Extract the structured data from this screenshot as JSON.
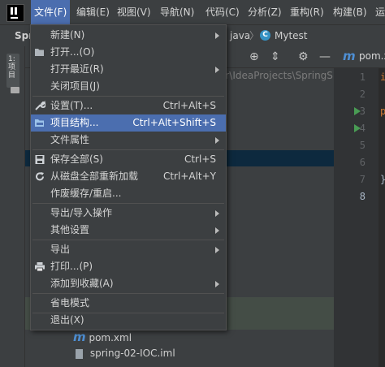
{
  "menubar": {
    "items": [
      {
        "label": "文件(F)"
      },
      {
        "label": "编辑(E)"
      },
      {
        "label": "视图(V)"
      },
      {
        "label": "导航(N)"
      },
      {
        "label": "代码(C)"
      },
      {
        "label": "分析(Z)"
      },
      {
        "label": "重构(R)"
      },
      {
        "label": "构建(B)"
      },
      {
        "label": "运"
      }
    ]
  },
  "navbar": {
    "project_fragment": "Spr",
    "crumb_java": "java",
    "crumb_class": "Mytest",
    "separator": "〉"
  },
  "left_strip": {
    "tab_label": "1: 项目"
  },
  "project_panel": {
    "path_fragment": "or\\IdeaProjects\\SpringS",
    "tree": [
      {
        "name": "pom.xml",
        "icon": "maven-icon"
      },
      {
        "name": "spring-02-IOC.iml",
        "icon": "module-file-icon"
      }
    ]
  },
  "editor": {
    "tab_label": "pom.x",
    "line_numbers": [
      "1",
      "2",
      "3",
      "4",
      "5",
      "6",
      "7",
      "8"
    ]
  },
  "file_menu": {
    "items": [
      {
        "label": "新建(N)",
        "shortcut": "",
        "submenu": true,
        "icon": ""
      },
      {
        "label": "打开...(O)",
        "shortcut": "",
        "submenu": false,
        "icon": "folder-open-icon"
      },
      {
        "label": "打开最近(R)",
        "shortcut": "",
        "submenu": true,
        "icon": ""
      },
      {
        "label": "关闭项目(J)",
        "shortcut": "",
        "submenu": false,
        "icon": ""
      },
      {
        "label": "设置(T)...",
        "shortcut": "Ctrl+Alt+S",
        "submenu": false,
        "icon": "wrench-icon"
      },
      {
        "label": "项目结构...",
        "shortcut": "Ctrl+Alt+Shift+S",
        "submenu": false,
        "icon": "project-structure-icon",
        "selected": true
      },
      {
        "label": "文件属性",
        "shortcut": "",
        "submenu": true,
        "icon": ""
      },
      {
        "label": "保存全部(S)",
        "shortcut": "Ctrl+S",
        "submenu": false,
        "icon": "save-icon"
      },
      {
        "label": "从磁盘全部重新加载",
        "shortcut": "Ctrl+Alt+Y",
        "submenu": false,
        "icon": "reload-icon"
      },
      {
        "label": "作废缓存/重启...",
        "shortcut": "",
        "submenu": false,
        "icon": ""
      },
      {
        "label": "导出/导入操作",
        "shortcut": "",
        "submenu": true,
        "icon": ""
      },
      {
        "label": "其他设置",
        "shortcut": "",
        "submenu": true,
        "icon": ""
      },
      {
        "label": "导出",
        "shortcut": "",
        "submenu": true,
        "icon": ""
      },
      {
        "label": "打印...(P)",
        "shortcut": "",
        "submenu": false,
        "icon": "print-icon"
      },
      {
        "label": "添加到收藏(A)",
        "shortcut": "",
        "submenu": true,
        "icon": ""
      },
      {
        "label": "省电模式",
        "shortcut": "",
        "submenu": false,
        "icon": ""
      },
      {
        "label": "退出(X)",
        "shortcut": "",
        "submenu": false,
        "icon": ""
      }
    ]
  },
  "colors": {
    "accent": "#4b6eaf",
    "background": "#2b2b2b",
    "panel": "#3c3f41"
  }
}
